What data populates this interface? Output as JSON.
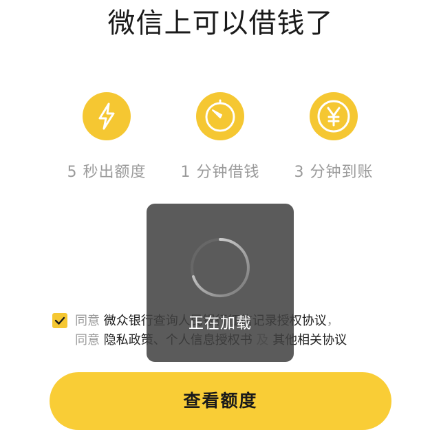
{
  "header": {
    "title": "微信上可以借钱了"
  },
  "features": [
    {
      "icon": "lightning-icon",
      "label": "5 秒出额度"
    },
    {
      "icon": "timer-icon",
      "label": "1 分钟借钱"
    },
    {
      "icon": "yen-icon",
      "label": "3 分钟到账"
    }
  ],
  "agreement": {
    "checked": true,
    "line1_prefix": "同意 ",
    "line1_link": "微众银行查询人民银行征信记录授权协议",
    "line1_suffix": "，",
    "line2_prefix": "同意 ",
    "line2_link1": "隐私政策、个人信息授权书",
    "line2_mid": " 及 ",
    "line2_link2": "其他相关协议"
  },
  "cta": {
    "label": "查看额度"
  },
  "loading": {
    "text": "正在加载"
  },
  "colors": {
    "accent": "#f5c732",
    "button": "#f9cd36",
    "muted_text": "#9a9a9a",
    "toast_bg": "#404040"
  }
}
